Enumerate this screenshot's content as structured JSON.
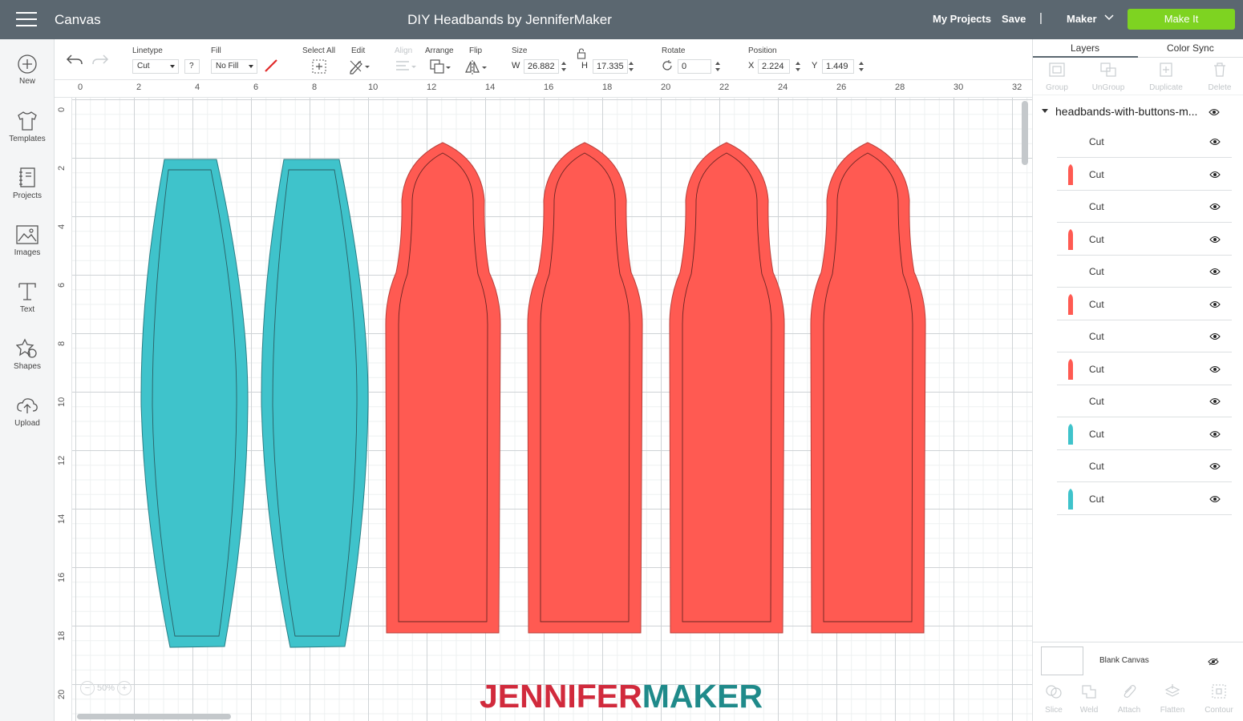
{
  "header": {
    "app_name": "Canvas",
    "doc_title": "DIY Headbands by JenniferMaker",
    "my_projects": "My Projects",
    "save": "Save",
    "separator": "|",
    "machine": "Maker",
    "make_it": "Make It"
  },
  "left_tools": [
    {
      "label": "New",
      "icon": "plus-circle-icon"
    },
    {
      "label": "Templates",
      "icon": "tshirt-icon"
    },
    {
      "label": "Projects",
      "icon": "projects-icon"
    },
    {
      "label": "Images",
      "icon": "image-icon"
    },
    {
      "label": "Text",
      "icon": "text-icon"
    },
    {
      "label": "Shapes",
      "icon": "shapes-icon"
    },
    {
      "label": "Upload",
      "icon": "upload-cloud-icon"
    }
  ],
  "toolbar": {
    "linetype_label": "Linetype",
    "linetype_value": "Cut",
    "linetype_help": "?",
    "fill_label": "Fill",
    "fill_value": "No Fill",
    "select_all_label": "Select All",
    "edit_label": "Edit",
    "align_label": "Align",
    "arrange_label": "Arrange",
    "flip_label": "Flip",
    "size_label": "Size",
    "w_label": "W",
    "w_value": "26.882",
    "h_label": "H",
    "h_value": "17.335",
    "rotate_label": "Rotate",
    "rotate_value": "0",
    "position_label": "Position",
    "x_label": "X",
    "x_value": "2.224",
    "y_label": "Y",
    "y_value": "1.449"
  },
  "ruler": {
    "top": [
      "0",
      "2",
      "4",
      "6",
      "8",
      "10",
      "12",
      "14",
      "16",
      "18",
      "20",
      "22",
      "24",
      "26",
      "28",
      "30",
      "32"
    ],
    "left": [
      "0",
      "2",
      "4",
      "6",
      "8",
      "10",
      "12",
      "14",
      "16",
      "18",
      "20"
    ]
  },
  "canvas": {
    "zoom": "50%",
    "minus": "−",
    "plus": "+",
    "brand_part1": "JENNIFER",
    "brand_part2": "MAKER"
  },
  "colors": {
    "teal": "#3fc3cb",
    "coral": "#ff5a52",
    "header": "#5b6770",
    "make_it": "#7ed321"
  },
  "layers_panel": {
    "tab_layers": "Layers",
    "tab_color_sync": "Color Sync",
    "tools": [
      "Group",
      "UnGroup",
      "Duplicate",
      "Delete"
    ],
    "group_name": "headbands-with-buttons-m...",
    "layers": [
      {
        "name": "Cut",
        "color": ""
      },
      {
        "name": "Cut",
        "color": "#ff5a52"
      },
      {
        "name": "Cut",
        "color": ""
      },
      {
        "name": "Cut",
        "color": "#ff5a52"
      },
      {
        "name": "Cut",
        "color": ""
      },
      {
        "name": "Cut",
        "color": "#ff5a52"
      },
      {
        "name": "Cut",
        "color": ""
      },
      {
        "name": "Cut",
        "color": "#ff5a52"
      },
      {
        "name": "Cut",
        "color": ""
      },
      {
        "name": "Cut",
        "color": "#3fc3cb"
      },
      {
        "name": "Cut",
        "color": ""
      },
      {
        "name": "Cut",
        "color": "#3fc3cb"
      }
    ],
    "blank_canvas": "Blank Canvas",
    "bottom_tools": [
      "Slice",
      "Weld",
      "Attach",
      "Flatten",
      "Contour"
    ]
  }
}
